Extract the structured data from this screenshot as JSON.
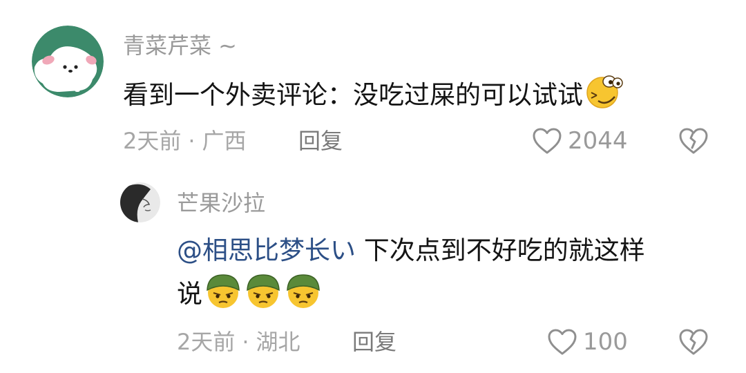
{
  "comment": {
    "username": "青菜芹菜 ~",
    "text": "看到一个外卖评论：没吃过屎的可以试试",
    "time": "2天前",
    "separator": "·",
    "location": "广西",
    "reply_label": "回复",
    "like_count": "2044",
    "emoji": "sly-smile-emoji"
  },
  "reply": {
    "username": "芒果沙拉",
    "mention": "@相思比梦长い",
    "text_line1": " 下次点到不好吃的就这样",
    "text_line2": "说",
    "time": "2天前",
    "separator": "·",
    "location": "湖北",
    "reply_label": "回复",
    "like_count": "100",
    "emoji": "soldier-helmet-emoji"
  },
  "icons": {
    "like": "heart-outline-icon",
    "dislike": "broken-heart-icon"
  }
}
